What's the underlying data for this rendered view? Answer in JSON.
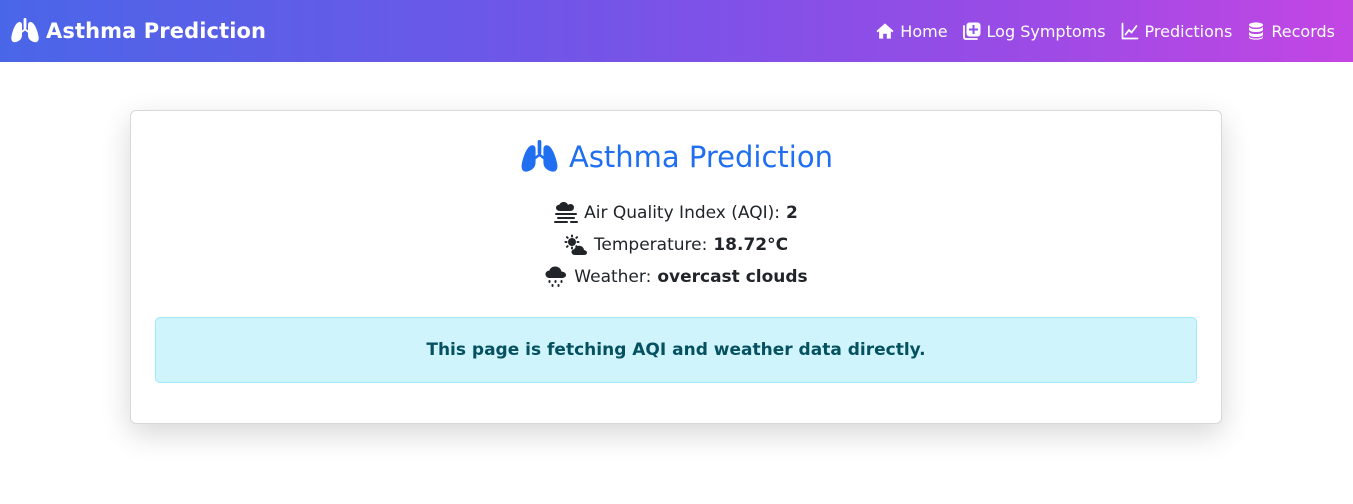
{
  "brand": {
    "title": "Asthma Prediction",
    "icon": "lungs-icon"
  },
  "nav": {
    "items": [
      {
        "label": "Home",
        "icon": "home-icon"
      },
      {
        "label": "Log Symptoms",
        "icon": "plus-square-icon"
      },
      {
        "label": "Predictions",
        "icon": "line-chart-icon"
      },
      {
        "label": "Records",
        "icon": "database-icon"
      }
    ]
  },
  "card": {
    "title": "Asthma Prediction",
    "title_color": "#1f6ff0",
    "lines": [
      {
        "icon": "smog-icon",
        "label": "Air Quality Index (AQI):",
        "value": "2"
      },
      {
        "icon": "cloud-sun-icon",
        "label": "Temperature:",
        "value": "18.72°C"
      },
      {
        "icon": "cloud-rain-icon",
        "label": "Weather:",
        "value": "overcast clouds"
      }
    ],
    "alert": "This page is fetching AQI and weather data directly."
  },
  "colors": {
    "navbar_gradient_start": "#4a66e8",
    "navbar_gradient_end": "#c346e3",
    "alert_bg": "#cff4fc",
    "alert_text": "#055160"
  }
}
